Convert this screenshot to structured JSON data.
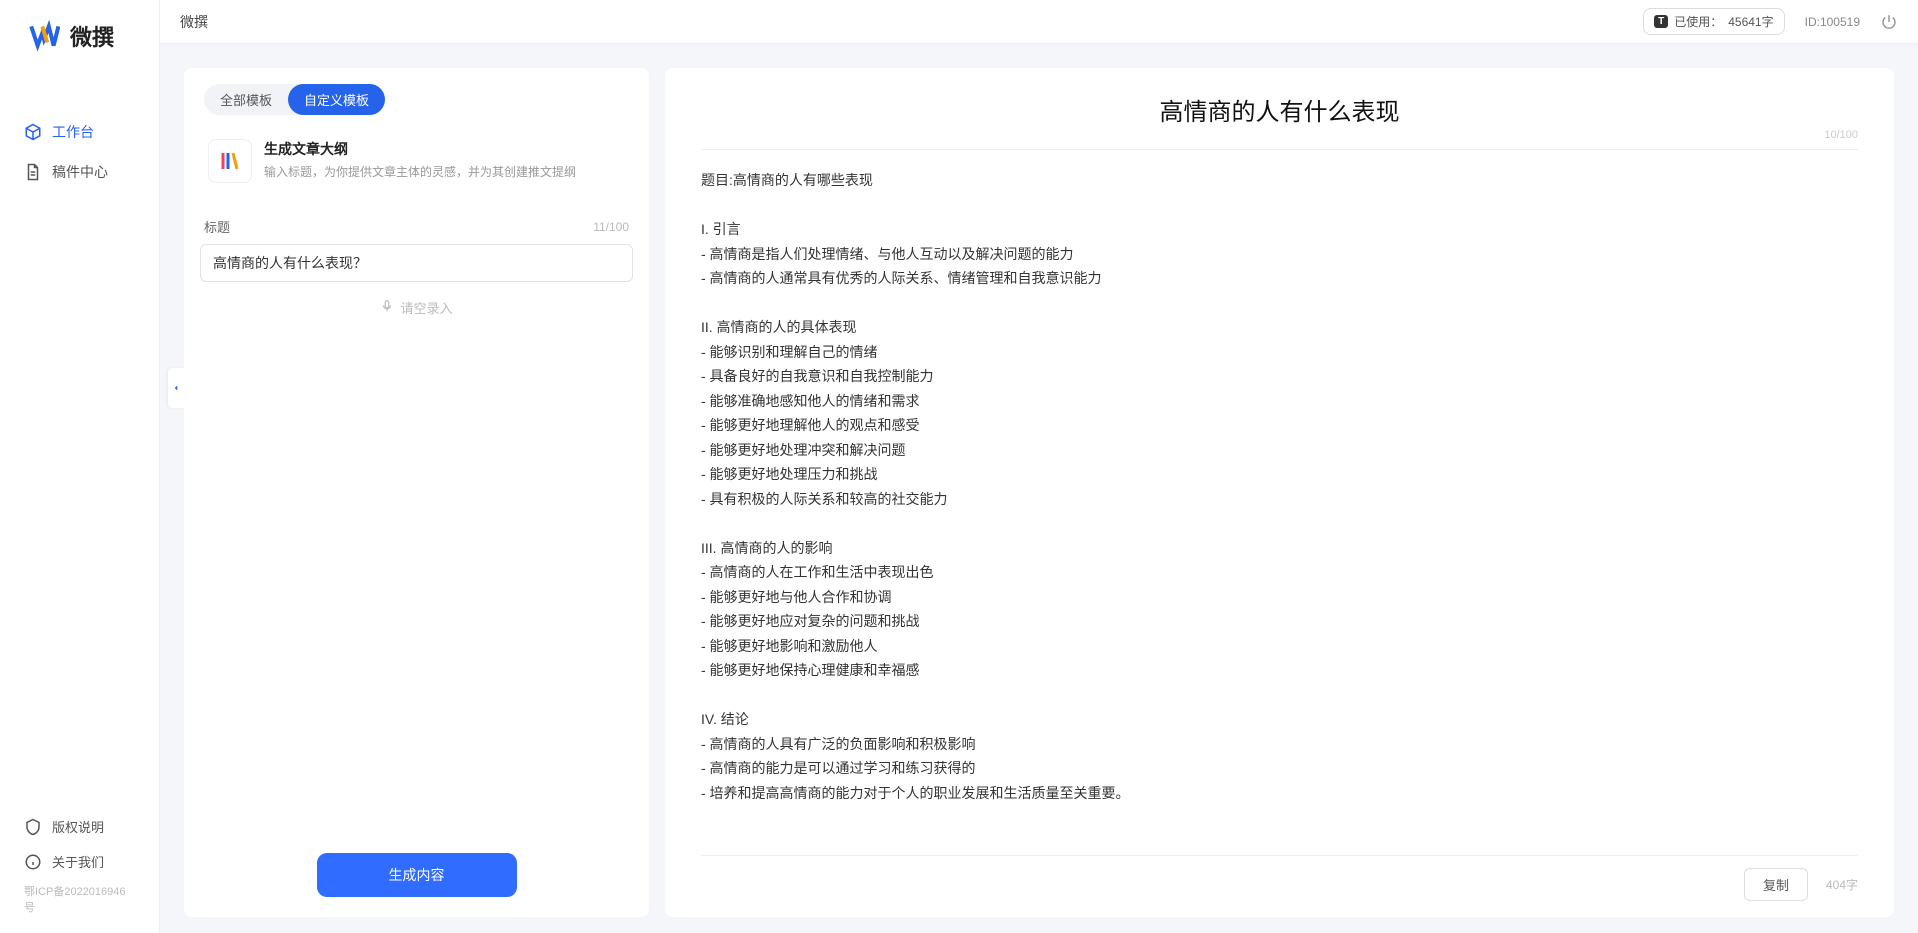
{
  "brand": {
    "name": "微撰"
  },
  "sidebar": {
    "nav": [
      {
        "label": "工作台",
        "active": true
      },
      {
        "label": "稿件中心",
        "active": false
      }
    ],
    "footer": [
      {
        "label": "版权说明"
      },
      {
        "label": "关于我们"
      }
    ],
    "icp": "鄂ICP备2022016946号"
  },
  "topbar": {
    "title": "微撰",
    "usage_prefix": "已使用：",
    "usage_value": "45641字",
    "id_label": "ID:100519"
  },
  "left": {
    "tabs": [
      {
        "label": "全部模板",
        "active": false
      },
      {
        "label": "自定义模板",
        "active": true
      }
    ],
    "template": {
      "title": "生成文章大纲",
      "desc": "输入标题，为你提供文章主体的灵感，并为其创建推文提纲"
    },
    "field": {
      "label": "标题",
      "count": "11/100",
      "value": "高情商的人有什么表现？"
    },
    "voice_label": "请空录入",
    "generate_label": "生成内容"
  },
  "right": {
    "title": "高情商的人有什么表现",
    "title_count": "10/100",
    "body": "题目:高情商的人有哪些表现\n\nI. 引言\n- 高情商是指人们处理情绪、与他人互动以及解决问题的能力\n- 高情商的人通常具有优秀的人际关系、情绪管理和自我意识能力\n\nII. 高情商的人的具体表现\n- 能够识别和理解自己的情绪\n- 具备良好的自我意识和自我控制能力\n- 能够准确地感知他人的情绪和需求\n- 能够更好地理解他人的观点和感受\n- 能够更好地处理冲突和解决问题\n- 能够更好地处理压力和挑战\n- 具有积极的人际关系和较高的社交能力\n\nIII. 高情商的人的影响\n- 高情商的人在工作和生活中表现出色\n- 能够更好地与他人合作和协调\n- 能够更好地应对复杂的问题和挑战\n- 能够更好地影响和激励他人\n- 能够更好地保持心理健康和幸福感\n\nIV. 结论\n- 高情商的人具有广泛的负面影响和积极影响\n- 高情商的能力是可以通过学习和练习获得的\n- 培养和提高高情商的能力对于个人的职业发展和生活质量至关重要。",
    "copy_label": "复制",
    "word_count": "404字"
  }
}
